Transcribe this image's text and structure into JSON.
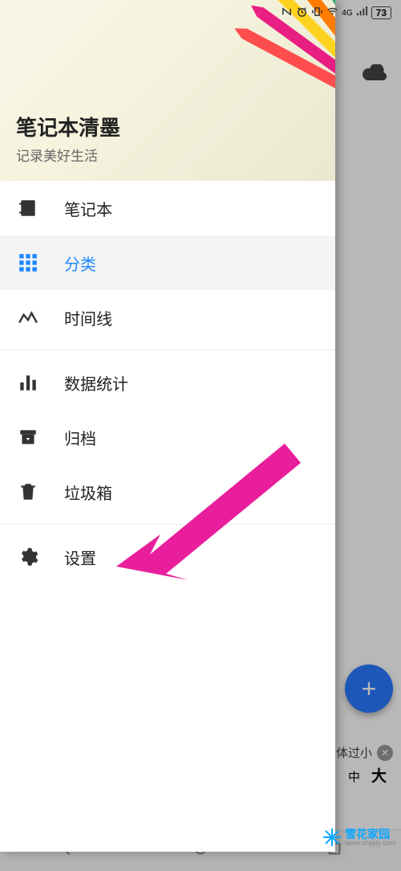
{
  "status": {
    "network": "4G",
    "battery": "73"
  },
  "drawer": {
    "title": "笔记本清墨",
    "subtitle": "记录美好生活",
    "items": [
      {
        "label": "笔记本",
        "icon": "notebook-icon",
        "active": false
      },
      {
        "label": "分类",
        "icon": "grid-icon",
        "active": true
      },
      {
        "label": "时间线",
        "icon": "timeline-icon",
        "active": false
      },
      {
        "label": "数据统计",
        "icon": "stats-icon",
        "active": false
      },
      {
        "label": "归档",
        "icon": "archive-icon",
        "active": false
      },
      {
        "label": "垃圾箱",
        "icon": "trash-icon",
        "active": false
      },
      {
        "label": "设置",
        "icon": "gear-icon",
        "active": false
      }
    ]
  },
  "behind": {
    "fab_label": "+",
    "tip_text": "体过小",
    "size_mid": "中",
    "size_big": "大"
  },
  "watermark": {
    "title": "雪花家园",
    "url": "www.xhjaty.com"
  }
}
